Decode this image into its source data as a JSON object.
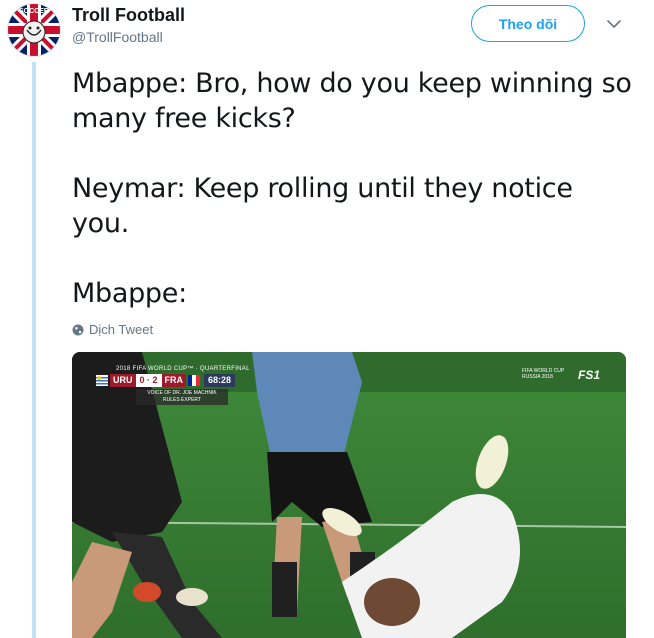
{
  "author": {
    "display_name": "Troll Football",
    "handle": "@TrollFootball",
    "avatar_text": "SOCCER"
  },
  "header": {
    "follow_label": "Theo dõi",
    "caret_icon": "chevron-down-icon"
  },
  "tweet": {
    "paragraphs": [
      "Mbappe: Bro, how do you keep winning so many free kicks?",
      "Neymar: Keep rolling until they notice you.",
      "Mbappe:"
    ],
    "translate_label": "Dịch Tweet",
    "translate_icon": "globe-icon"
  },
  "media": {
    "scorebug": {
      "title": "2018 FIFA WORLD CUP™ · QUARTERFINAL",
      "home": "URU",
      "score": "0 · 2",
      "away": "FRA",
      "clock": "68:28",
      "overlay": "VOICE OF DR. JOE MACHNIK RULES EXPERT"
    },
    "wc_logo": "FIFA WORLD CUP RUSSIA 2018",
    "channel": "FS1"
  },
  "colors": {
    "accent": "#1da1f2",
    "thread_line": "#c4e2f7",
    "text": "#14171a",
    "muted": "#657786"
  }
}
